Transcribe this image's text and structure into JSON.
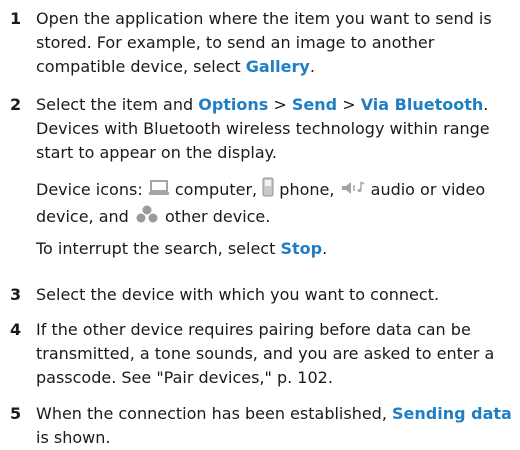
{
  "steps": [
    {
      "number": "1",
      "text_a": "Open the application where the item you want to send is stored. For example, to send an image to another compatible device, select ",
      "link_gallery": "Gallery",
      "text_end": "."
    },
    {
      "number": "2",
      "text_a": "Select the item and ",
      "link_options": "Options",
      "sep1": " > ",
      "link_send": "Send",
      "sep2": " > ",
      "link_via_bt": "Via Bluetooth",
      "text_b": ". Devices with Bluetooth wireless technology within range start to appear on the display.",
      "icons_prefix": "Device icons: ",
      "icon_computer_label": " computer, ",
      "icon_phone_label": " phone, ",
      "icon_audio_label": " audio or video device, and ",
      "icon_other_label": " other device.",
      "interrupt_a": "To interrupt the search, select ",
      "link_stop": "Stop",
      "interrupt_end": "."
    },
    {
      "number": "3",
      "text_a": "Select the device with which you want to connect."
    },
    {
      "number": "4",
      "text_a": "If the other device requires pairing before data can be transmitted, a tone sounds, and you are asked to enter a passcode. See \"Pair devices,\" p. 102."
    },
    {
      "number": "5",
      "text_a": "When the connection has been established, ",
      "link_sending_data": "Sending data",
      "text_b": " is shown."
    }
  ],
  "colors": {
    "link": "#1e7fc4",
    "icon_gray": "#a5a5a5",
    "text": "#1a1a1a"
  },
  "icons": [
    "computer-icon",
    "phone-icon",
    "audio-video-icon",
    "other-device-icon"
  ]
}
